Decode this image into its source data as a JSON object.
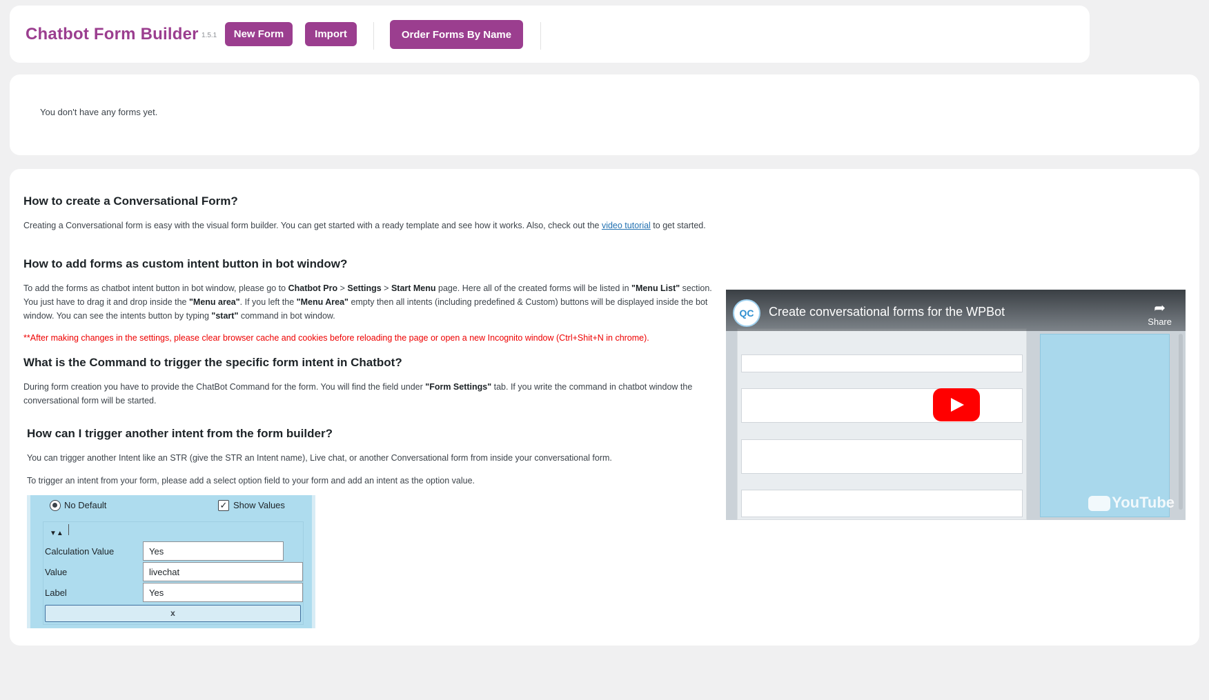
{
  "header": {
    "title": "Chatbot Form Builder",
    "version": "1.5.1",
    "new_form_label": "New Form",
    "import_label": "Import",
    "order_label": "Order Forms By Name"
  },
  "forms": {
    "empty_message": "You don't have any forms yet."
  },
  "help": {
    "q1": {
      "title": "How to create a Conversational Form?",
      "text_before": "Creating a Conversational form is easy with the visual form builder. You can get started with a ready template and see how it works. Also, check out the ",
      "link": "video tutorial",
      "text_after": " to get started."
    },
    "q2": {
      "title": "How to add forms as custom intent button in bot window?",
      "p1": "To add the forms as chatbot intent button in bot window, please go to ",
      "b1": "Chatbot Pro",
      "p2": " > ",
      "b2": "Settings",
      "p3": " > ",
      "b3": "Start Menu",
      "p4": " page. Here all of the created forms will be listed in ",
      "b4": "\"Menu List\"",
      "p5": " section. You just have to drag it and drop inside the ",
      "b5": "\"Menu area\"",
      "p6": ". If you left the ",
      "b6": "\"Menu Area\"",
      "p7": " empty then all intents (including predefined & Custom) buttons will be displayed inside the bot window. You can see the intents button by typing ",
      "b7": "\"start\"",
      "p8": " command in bot window.",
      "warning": "**After making changes in the settings, please clear browser cache and cookies before reloading the page or open a new Incognito window (Ctrl+Shit+N in chrome)."
    },
    "q3": {
      "title": "What is the Command to trigger the specific form intent in Chatbot?",
      "p1": "During form creation you have to provide the ChatBot Command for the form. You will find the field under ",
      "b1": "\"Form Settings\"",
      "p2": " tab. If you write the command in chatbot window the conversational form will be started."
    },
    "q4": {
      "title": "How can I trigger another intent from the form builder?",
      "p1": "You can trigger another Intent like an STR (give the STR an Intent name), Live chat, or another Conversational form from inside your conversational form.",
      "p2": "To trigger an intent from your form, please add a select option field to your form and add an intent as the option value."
    }
  },
  "example": {
    "no_default": "No Default",
    "show_values": "Show Values",
    "calc_label": "Calculation Value",
    "calc_value": "Yes",
    "value_label": "Value",
    "value_value": "livechat",
    "label_label": "Label",
    "label_value": "Yes",
    "remove": "x"
  },
  "video": {
    "title": "Create conversational forms for the WPBot",
    "share": "Share",
    "youtube": "YouTube"
  },
  "colors": {
    "brand": "#9b3e8f",
    "link": "#2271b1",
    "warning": "#ee0000"
  }
}
